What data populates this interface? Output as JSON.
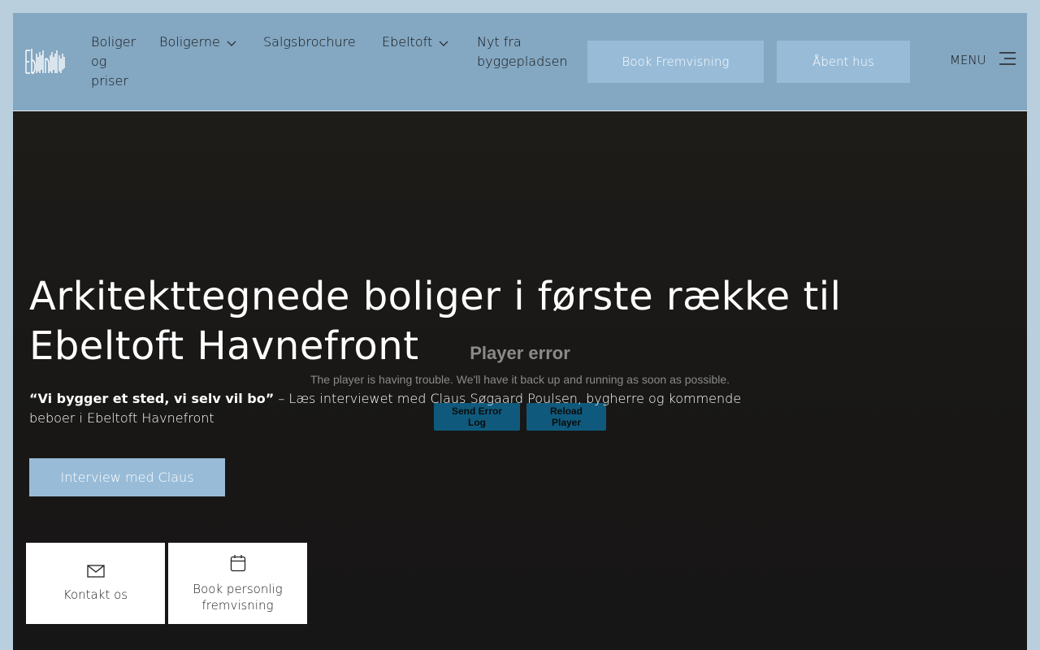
{
  "header": {
    "logo_text": "Ebeltoft Havnefront",
    "nav": [
      {
        "label": "Boliger og priser",
        "has_dropdown": false
      },
      {
        "label": "Boligerne",
        "has_dropdown": true
      },
      {
        "label": "Salgsbrochure",
        "has_dropdown": false
      },
      {
        "label": "Ebeltoft",
        "has_dropdown": true
      },
      {
        "label": "Nyt fra byggepladsen",
        "has_dropdown": false
      }
    ],
    "buttons": {
      "book_viewing": "Book Fremvisning",
      "open_house": "Åbent hus"
    },
    "menu_label": "MENU"
  },
  "player_error": {
    "title": "Player error",
    "message": "The player is having trouble. We'll have it back up and running as soon as possible.",
    "send_log": "Send Error Log",
    "reload": "Reload Player"
  },
  "hero": {
    "title_line1": "Arkitekttegnede boliger i første række til",
    "title_line2": "Ebeltoft Havnefront",
    "quote": "“Vi bygger et sted, vi selv vil bo”",
    "subtitle": " – Læs interviewet med Claus Søgaard Poulsen, bygherre og kommende beboer i Ebeltoft Havnefront",
    "cta": "Interview med Claus"
  },
  "cards": {
    "contact": "Kontakt os",
    "book_personal_line1": "Book personlig",
    "book_personal_line2": "fremvisning"
  },
  "colors": {
    "header_bg": "#84a7c2",
    "button_bg": "#98bcd8",
    "page_bg": "#b9cfdd",
    "hero_bg": "#1b1a18",
    "player_btn": "#0f5a7c"
  },
  "icons": {
    "dropdown": "chevron-down-icon",
    "menu": "hamburger-menu-icon",
    "contact": "envelope-icon",
    "booking": "calendar-icon"
  }
}
